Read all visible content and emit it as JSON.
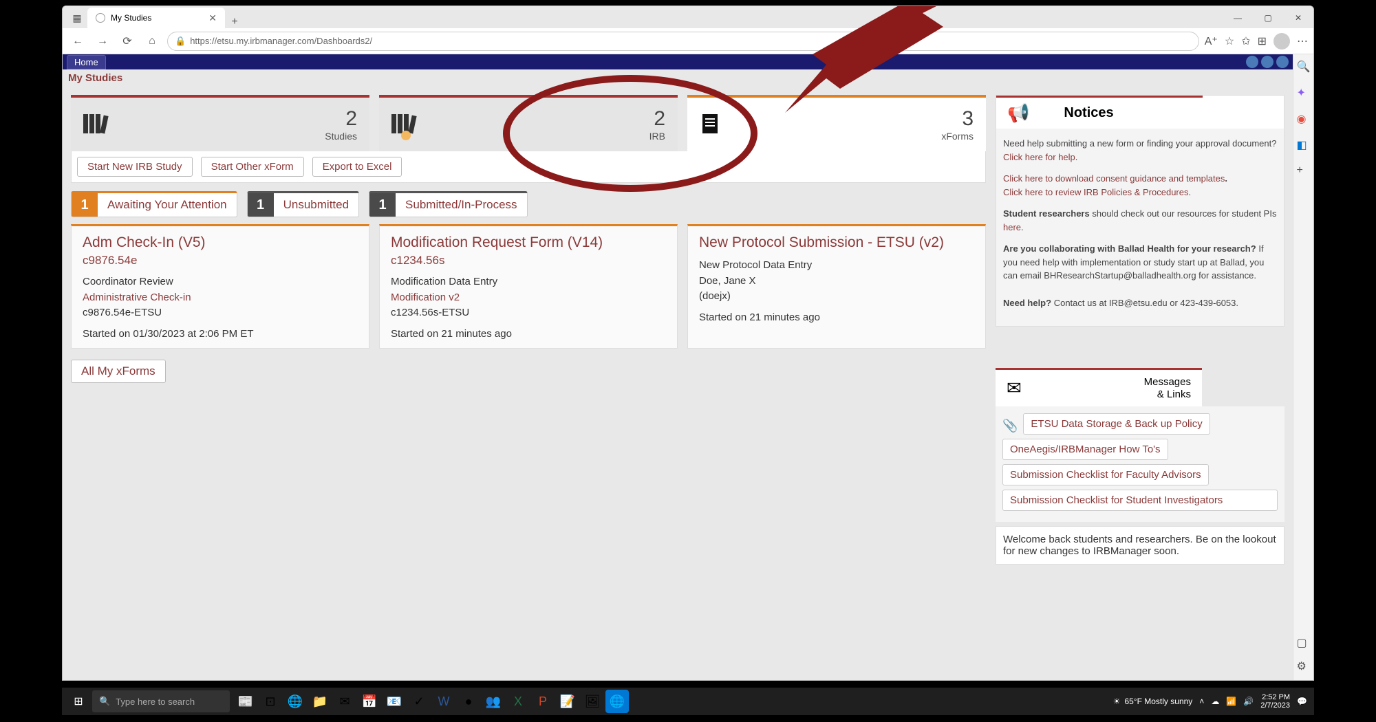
{
  "browser": {
    "tab_title": "My Studies",
    "url": "https://etsu.my.irbmanager.com/Dashboards2/"
  },
  "header": {
    "home": "Home",
    "page_title": "My Studies"
  },
  "stats": [
    {
      "count": "2",
      "label": "Studies"
    },
    {
      "count": "2",
      "label": "IRB"
    },
    {
      "count": "3",
      "label": "xForms"
    }
  ],
  "actions": {
    "start_irb": "Start New IRB Study",
    "start_other": "Start Other xForm",
    "export": "Export to Excel"
  },
  "filters": [
    {
      "count": "1",
      "label": "Awaiting Your Attention"
    },
    {
      "count": "1",
      "label": "Unsubmitted"
    },
    {
      "count": "1",
      "label": "Submitted/In-Process"
    }
  ],
  "cards": [
    {
      "title": "Adm Check-In (V5)",
      "id": "c9876.54e",
      "line1": "Coordinator Review",
      "line2": "Administrative Check-in",
      "line3": "c9876.54e-ETSU",
      "started": "Started on 01/30/2023 at 2:06 PM ET"
    },
    {
      "title": "Modification Request Form (V14)",
      "id": "c1234.56s",
      "line1": "Modification Data Entry",
      "line2": "Modification v2",
      "line3": "c1234.56s-ETSU",
      "started": "Started on 21 minutes ago"
    },
    {
      "title": "New Protocol Submission - ETSU (v2)",
      "id": "",
      "line1": "New Protocol Data Entry",
      "line2": "Doe, Jane X",
      "line3": "(doejx)",
      "started": "Started on 21 minutes ago"
    }
  ],
  "all_xforms": "All My xForms",
  "notices": {
    "title": "Notices",
    "p1a": "Need help submitting a new form or finding your approval document? ",
    "p1_link": "Click here for help",
    "p2_link": "Click here to download consent guidance and templates",
    "p3_link": "Click here to review IRB Policies & Procedures",
    "p4a": "Student researchers",
    "p4b": " should check out our resources for student PIs ",
    "p4_link": "here",
    "p5a": "Are you collaborating with Ballad Health for your research?",
    "p5b": " If you need help with implementation or study start up at Ballad, you can email BHResearchStartup@balladhealth.org for assistance.",
    "p6a": "Need help?",
    "p6b": " Contact us at IRB@etsu.edu or 423-439-6053."
  },
  "messages": {
    "title1": "Messages",
    "title2": "& Links",
    "links": [
      "ETSU Data Storage & Back up Policy",
      "OneAegis/IRBManager How To's",
      "Submission Checklist for Faculty Advisors",
      "Submission Checklist for Student Investigators"
    ],
    "welcome": "Welcome back students and researchers.  Be on the lookout for new changes to IRBManager soon."
  },
  "taskbar": {
    "search_placeholder": "Type here to search",
    "weather": "65°F  Mostly sunny",
    "time": "2:52 PM",
    "date": "2/7/2023"
  }
}
